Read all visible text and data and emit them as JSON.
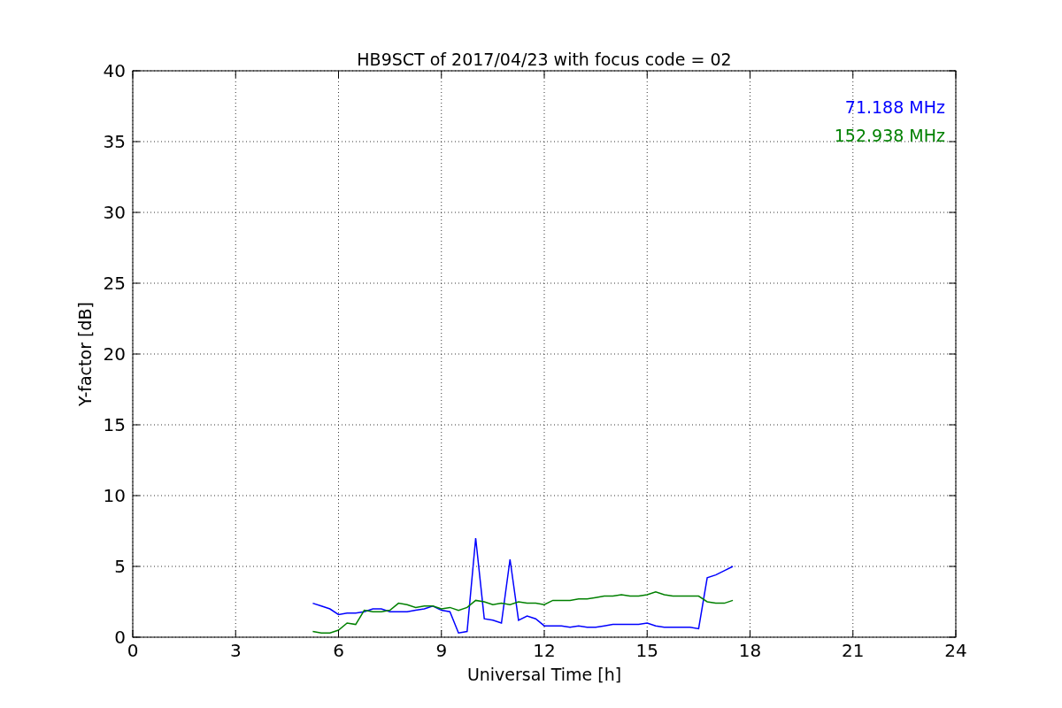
{
  "chart_data": {
    "type": "line",
    "title": "HB9SCT of 2017/04/23 with focus code = 02",
    "xlabel": "Universal Time [h]",
    "ylabel": "Y-factor [dB]",
    "x": [
      5.25,
      5.5,
      5.75,
      6.0,
      6.25,
      6.5,
      6.75,
      7.0,
      7.25,
      7.5,
      7.75,
      8.0,
      8.25,
      8.5,
      8.75,
      9.0,
      9.25,
      9.5,
      9.75,
      10.0,
      10.25,
      10.5,
      10.75,
      11.0,
      11.25,
      11.5,
      11.75,
      12.0,
      12.25,
      12.5,
      12.75,
      13.0,
      13.25,
      13.5,
      13.75,
      14.0,
      14.25,
      14.5,
      14.75,
      15.0,
      15.25,
      15.5,
      15.75,
      16.0,
      16.25,
      16.5,
      16.75,
      17.0,
      17.25,
      17.5
    ],
    "series": [
      {
        "name": "71.188 MHz",
        "color": "#0000ff",
        "values": [
          2.4,
          2.2,
          2.0,
          1.6,
          1.7,
          1.7,
          1.8,
          2.0,
          2.0,
          1.8,
          1.8,
          1.8,
          1.9,
          2.0,
          2.2,
          1.9,
          1.8,
          0.3,
          0.4,
          7.0,
          1.3,
          1.2,
          1.0,
          5.5,
          1.2,
          1.5,
          1.3,
          0.8,
          0.8,
          0.8,
          0.7,
          0.8,
          0.7,
          0.7,
          0.8,
          0.9,
          0.9,
          0.9,
          0.9,
          1.0,
          0.8,
          0.7,
          0.7,
          0.7,
          0.7,
          0.6,
          4.2,
          4.4,
          4.7,
          5.0
        ]
      },
      {
        "name": "152.938 MHz",
        "color": "#008000",
        "values": [
          0.4,
          0.3,
          0.3,
          0.5,
          1.0,
          0.9,
          1.9,
          1.8,
          1.8,
          1.9,
          2.4,
          2.3,
          2.1,
          2.2,
          2.2,
          2.0,
          2.1,
          1.9,
          2.1,
          2.6,
          2.5,
          2.3,
          2.4,
          2.3,
          2.5,
          2.4,
          2.4,
          2.3,
          2.6,
          2.6,
          2.6,
          2.7,
          2.7,
          2.8,
          2.9,
          2.9,
          3.0,
          2.9,
          2.9,
          3.0,
          3.2,
          3.0,
          2.9,
          2.9,
          2.9,
          2.9,
          2.5,
          2.4,
          2.4,
          2.6
        ]
      }
    ],
    "grid": true,
    "xlim": [
      0,
      24
    ],
    "ylim": [
      0,
      40
    ],
    "xticks": [
      0,
      3,
      6,
      9,
      12,
      15,
      18,
      21,
      24
    ],
    "yticks": [
      0,
      5,
      10,
      15,
      20,
      25,
      30,
      35,
      40
    ]
  }
}
